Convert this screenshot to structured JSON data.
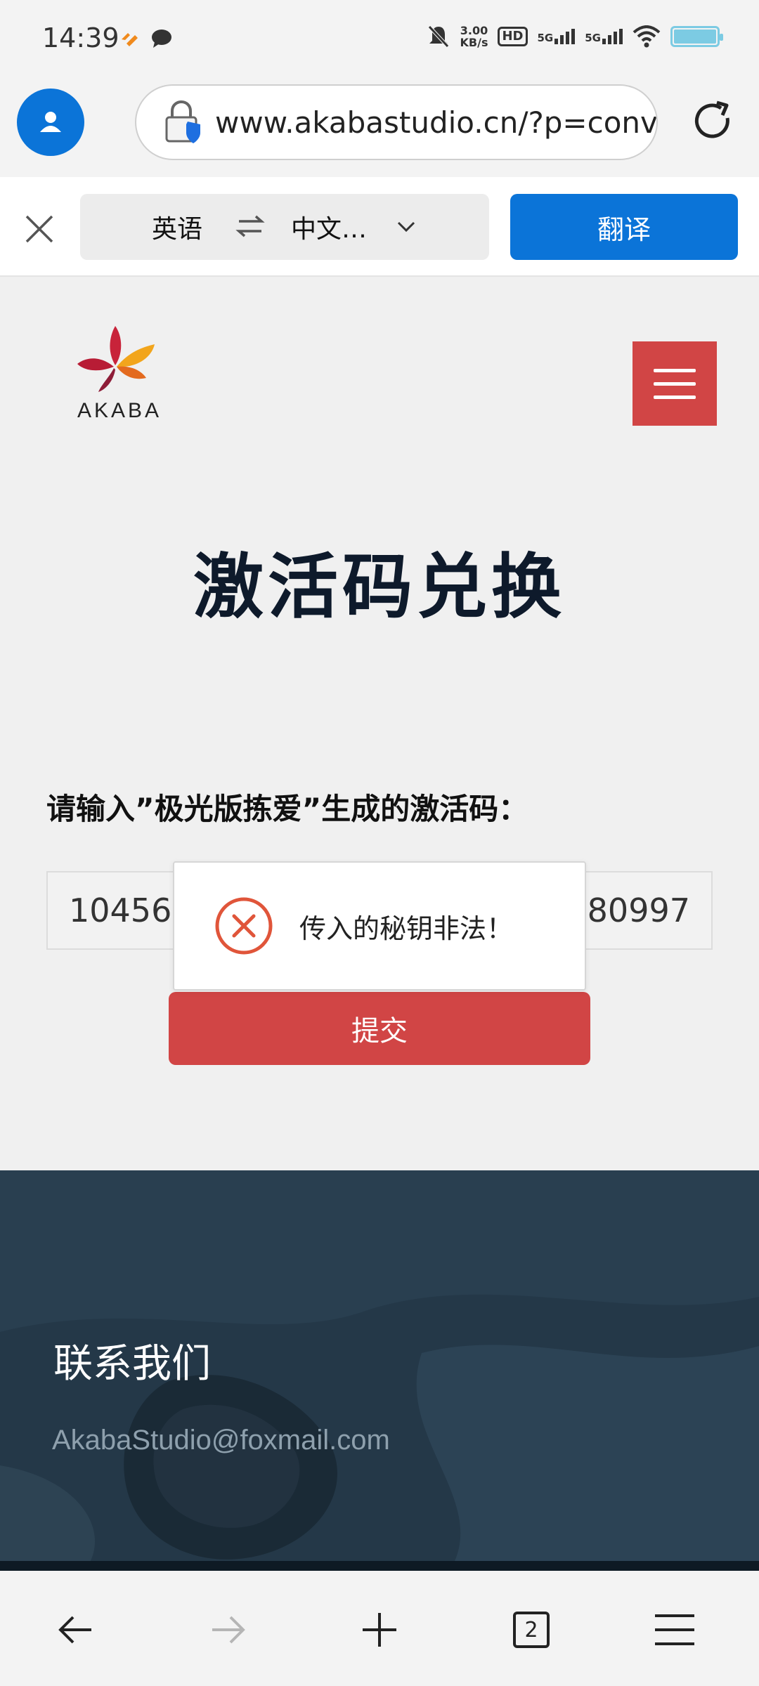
{
  "status_bar": {
    "time": "14:39",
    "net_speed_value": "3.00",
    "net_speed_unit": "KB/s",
    "hd_label": "HD",
    "sim1_label": "5G",
    "sim2_label": "5G",
    "icons": [
      "huawei-icon",
      "chat-icon",
      "mute-icon",
      "hd-icon",
      "signal-icon",
      "wifi-icon",
      "battery-icon"
    ]
  },
  "browser": {
    "url": "www.akabastudio.cn/?p=conve",
    "icons": [
      "profile-icon",
      "lock-shield-icon",
      "refresh-icon"
    ]
  },
  "translate_bar": {
    "source_lang": "英语",
    "target_lang": "中文…",
    "translate_label": "翻译"
  },
  "site": {
    "logo_text": "AKABA",
    "title": "激活码兑换",
    "prompt": "请输入”极光版拣爱”生成的激活码：",
    "code_left": "104568",
    "code_right": "480997",
    "submit_label": "提交"
  },
  "toast": {
    "message": "传入的秘钥非法！"
  },
  "footer": {
    "title": "联系我们",
    "email": "AkabaStudio@foxmail.com"
  },
  "bottom_nav": {
    "tab_count": "2"
  },
  "colors": {
    "accent_blue": "#0b74d8",
    "brand_red": "#d14545",
    "footer_bg": "#223544",
    "error_orange": "#e0553a"
  }
}
